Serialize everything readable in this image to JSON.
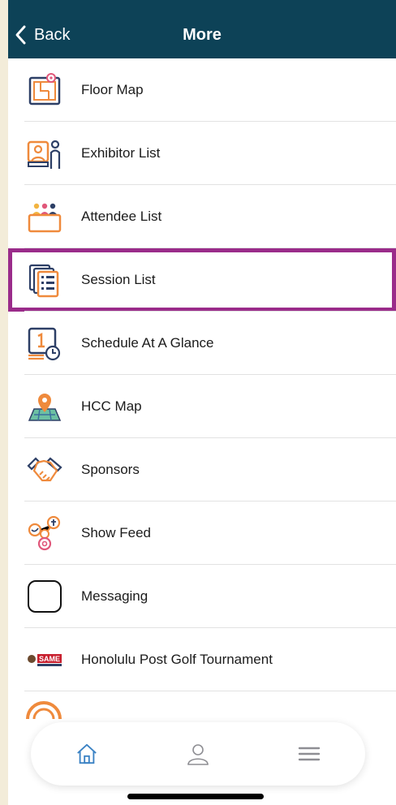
{
  "header": {
    "back_label": "Back",
    "title": "More"
  },
  "menu": {
    "items": [
      {
        "label": "Floor Map",
        "icon": "floor-map-icon"
      },
      {
        "label": "Exhibitor List",
        "icon": "exhibitor-icon"
      },
      {
        "label": "Attendee List",
        "icon": "attendee-icon"
      },
      {
        "label": "Session List",
        "icon": "session-list-icon"
      },
      {
        "label": "Schedule At A Glance",
        "icon": "schedule-calendar-icon"
      },
      {
        "label": "HCC Map",
        "icon": "map-pin-icon"
      },
      {
        "label": "Sponsors",
        "icon": "handshake-icon"
      },
      {
        "label": "Show Feed",
        "icon": "social-feed-icon"
      },
      {
        "label": "Messaging",
        "icon": "messaging-icon"
      },
      {
        "label": "Honolulu Post Golf Tournament",
        "icon": "same-logo-icon"
      }
    ],
    "highlighted_index": 3
  },
  "tabbar": {
    "tabs": [
      {
        "name": "home",
        "icon": "home-icon",
        "active": true
      },
      {
        "name": "profile",
        "icon": "person-icon",
        "active": false
      },
      {
        "name": "menu",
        "icon": "hamburger-icon",
        "active": false
      }
    ]
  },
  "colors": {
    "header_bg": "#0d4257",
    "highlight": "#9a2c8a",
    "icon_orange": "#ef8a3c",
    "icon_navy": "#2d3f66",
    "active_tab": "#3b82c4"
  }
}
